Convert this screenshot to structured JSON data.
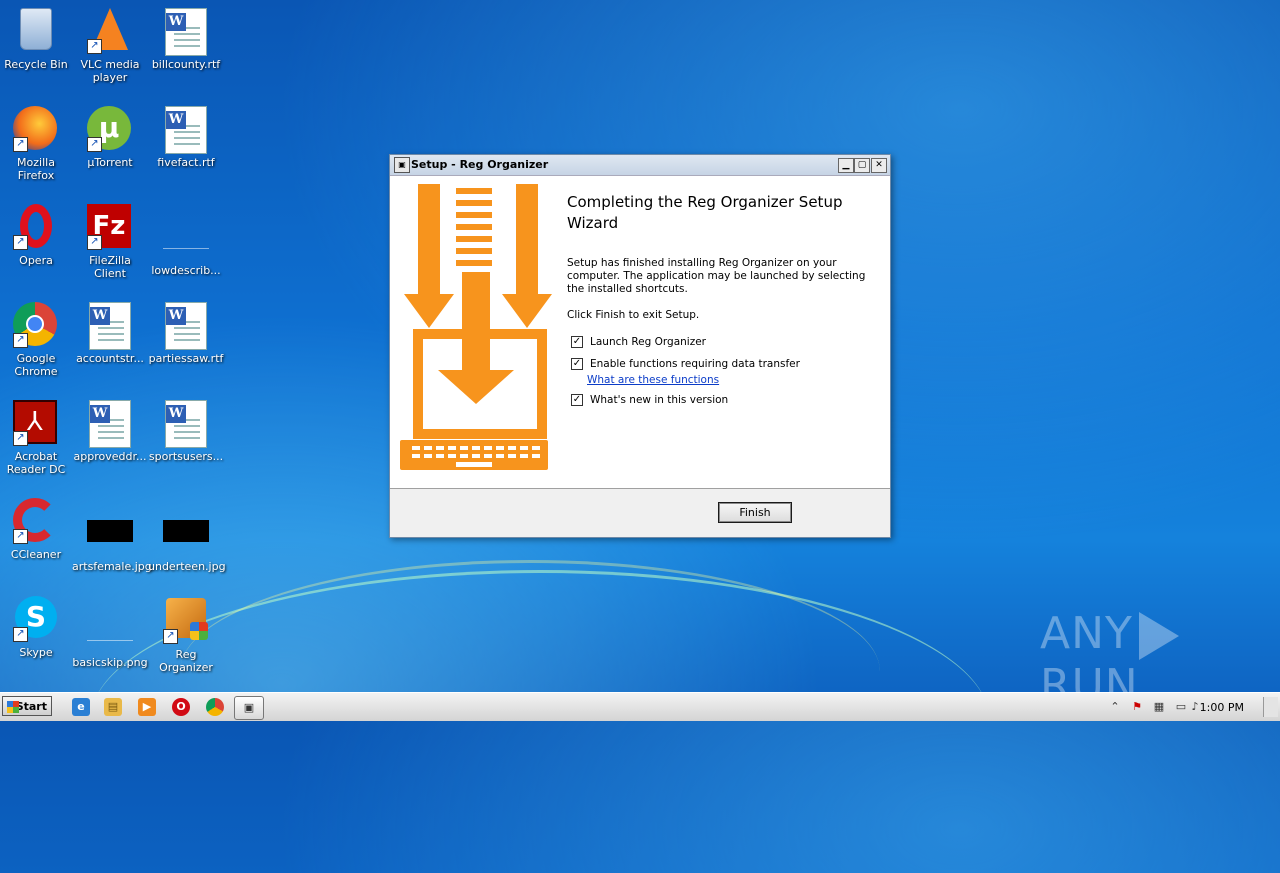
{
  "desktop": {
    "icons": [
      {
        "label": "Recycle Bin"
      },
      {
        "label": "VLC media\nplayer"
      },
      {
        "label": "billcounty.rtf"
      },
      {
        "label": "Mozilla Firefox"
      },
      {
        "label": "µTorrent"
      },
      {
        "label": "fivefact.rtf"
      },
      {
        "label": "Opera"
      },
      {
        "label": "FileZilla Client"
      },
      {
        "label": "lowdescrib..."
      },
      {
        "label": "Google\nChrome"
      },
      {
        "label": "accountstr..."
      },
      {
        "label": "partiessaw.rtf"
      },
      {
        "label": "Acrobat\nReader DC"
      },
      {
        "label": "approveddr..."
      },
      {
        "label": "sportsusers..."
      },
      {
        "label": "CCleaner"
      },
      {
        "label": "artsfemale.jpg"
      },
      {
        "label": "underteen.jpg"
      },
      {
        "label": "Skype"
      },
      {
        "label": "basicskip.png"
      },
      {
        "label": "Reg Organizer"
      }
    ]
  },
  "window": {
    "title": "Setup - Reg Organizer",
    "heading": "Completing the Reg Organizer Setup Wizard",
    "description": "Setup has finished installing Reg Organizer on your computer. The application may be launched by selecting the installed shortcuts.",
    "instruction": "Click Finish to exit Setup.",
    "checkboxes": [
      {
        "label": "Launch Reg Organizer",
        "checked": true
      },
      {
        "label": "Enable functions requiring data transfer",
        "checked": true
      },
      {
        "label": "What's new in this version",
        "checked": true
      }
    ],
    "link": "What are these functions",
    "finish_label": "Finish",
    "accent_color": "#f7941d"
  },
  "taskbar": {
    "start_label": "Start",
    "clock": "1:00 PM"
  },
  "watermark": {
    "left": "ANY",
    "right": "RUN"
  }
}
